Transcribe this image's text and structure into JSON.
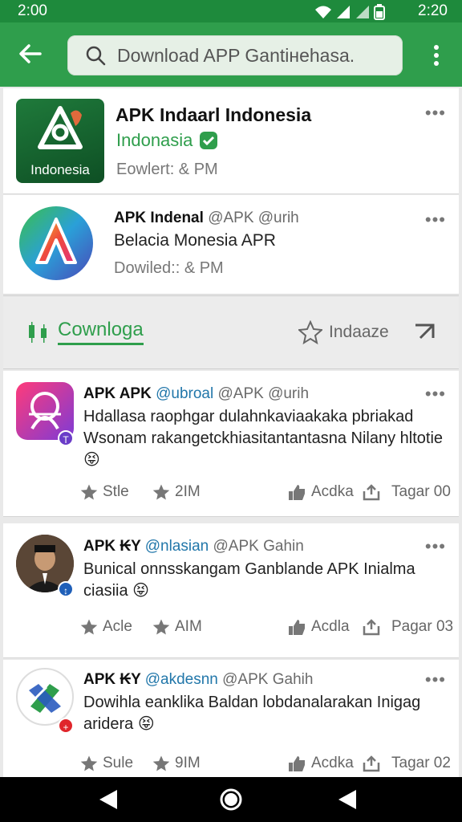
{
  "status": {
    "time_left": "2:00",
    "time_right": "2:20"
  },
  "search": {
    "text": "Download APP Gantiнehasa."
  },
  "cards": [
    {
      "title": "APK Indaarl Indonesia",
      "subtitle": "Indonasia",
      "meta": "Eowlert: & PM",
      "tile_label": "Indonesia",
      "more": "•••"
    },
    {
      "name": "APK Indenal",
      "handle": "@APK @urih",
      "subtitle": "Belacia Monesia APR",
      "meta": "Dowiled:: & PM",
      "more": "•••"
    }
  ],
  "tabs": {
    "download": "Cownloga",
    "star": "Indaaze"
  },
  "posts": [
    {
      "name": "APK APK",
      "handle1": "@ubroal",
      "handle2": "@APK @urih",
      "body": "Hdallasa raophgar dulahnkaviaakaka pbriakad Wsonam rakangetckhiasitantantasna Nilany hltotie 😝",
      "a1": "Stle",
      "a2": "2IM",
      "a3": "Acdka",
      "a4": "Tagar 00",
      "more": "•••"
    },
    {
      "name": "APK ₭Y",
      "handle1": "@nlasian",
      "handle2": "@APK Gahin",
      "body": "Bunical onnsskangam Ganblande APK Inialma ciasiia 😝",
      "a1": "Acle",
      "a2": "AIM",
      "a3": "Acdla",
      "a4": "Pagar 03",
      "more": "•••"
    },
    {
      "name": "APK ₭Y",
      "handle1": "@akdesnn",
      "handle2": "@APK Gahih",
      "body": "Dowihla eanklika Baldan lobdanalarakan Inigag aridera 😝",
      "a1": "Sule",
      "a2": "9IM",
      "a3": "Acdka",
      "a4": "Tagar 02",
      "more": "•••"
    }
  ],
  "colors": {
    "green": "#2f9e4c",
    "dark_green": "#1e8a3c",
    "blue": "#2277aa"
  }
}
